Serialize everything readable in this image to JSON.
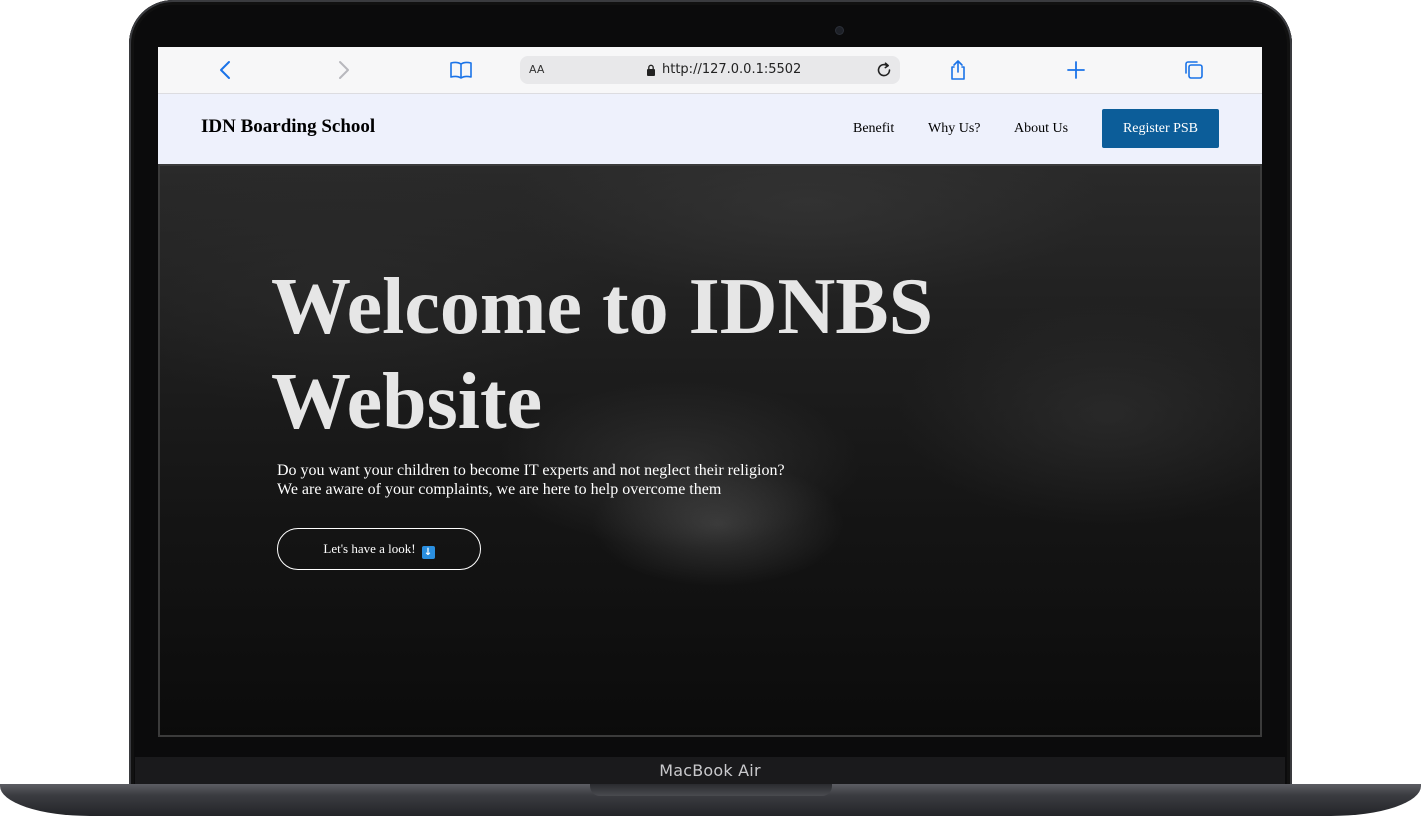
{
  "device": {
    "label": "MacBook Air"
  },
  "browser": {
    "text_size_label": "AA",
    "url": "http://127.0.0.1:5502",
    "icons": [
      "back-icon",
      "forward-icon",
      "bookmarks-icon",
      "lock-icon",
      "reload-icon",
      "share-icon",
      "new-tab-icon",
      "tabs-icon"
    ]
  },
  "navbar": {
    "brand": "IDN Boarding School",
    "links": [
      "Benefit",
      "Why Us?",
      "About Us"
    ],
    "cta": "Register PSB",
    "cta_color": "#0c5d99",
    "background": "#eef1fc"
  },
  "hero": {
    "title_line1": "Welcome to IDNBS",
    "title_line2": "Website",
    "subtitle_line1": "Do you want your children to become IT experts and not neglect their religion?",
    "subtitle_line2": "We are aware of your complaints, we are here to help overcome them",
    "button": "Let's have a look!",
    "button_icon": "down-arrow-icon"
  },
  "floating": {
    "icon": "whatsapp-icon",
    "color": "#0c5d99"
  }
}
